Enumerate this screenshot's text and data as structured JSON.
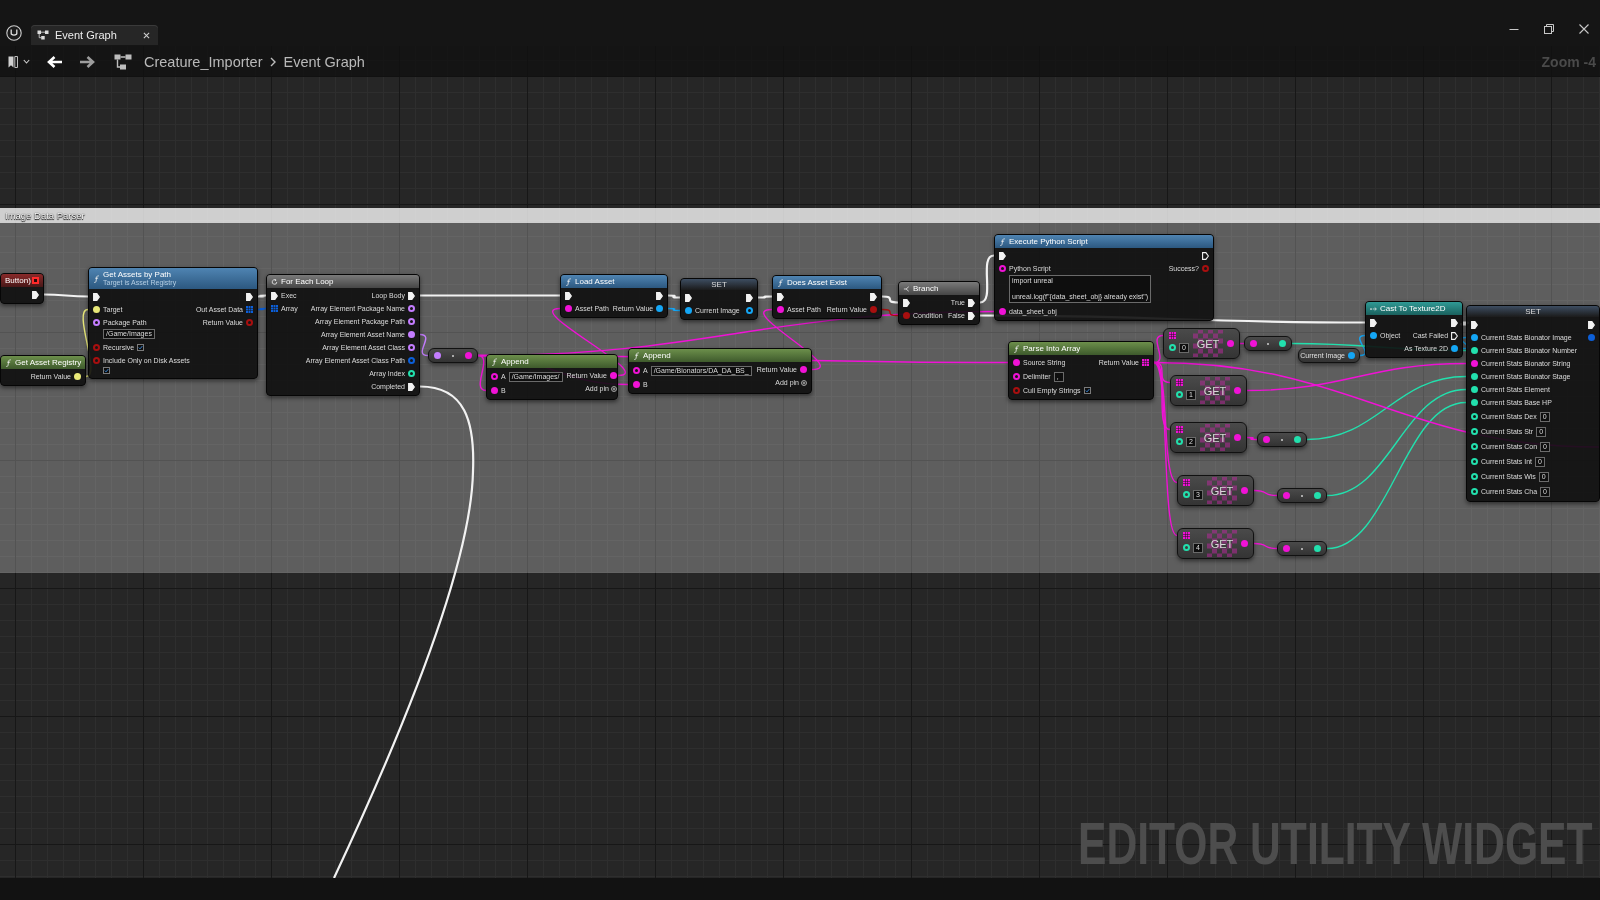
{
  "tabs": [
    {
      "label": "Event Graph",
      "selected": true
    }
  ],
  "nav_buttons": [
    {
      "disabled": false
    },
    {
      "disabled": true
    }
  ],
  "breadcrumb": [
    "Creature_Importer",
    "Event Graph"
  ],
  "zoom_label": "Zoom -4",
  "comment": {
    "title": "Image Data Parser"
  },
  "nodes": [
    {
      "kind": "event",
      "title": "Button)",
      "outputs": [
        {
          "kind": "delegate",
          "color": "#ff2a2a",
          "linked": false
        },
        {
          "kind": "exec",
          "linked": true
        }
      ]
    },
    {
      "kind": "function",
      "title": "Get Assets by Path",
      "subtitle": "Target is Asset Registry",
      "inputs": [
        {
          "kind": "exec",
          "linked": true
        },
        {
          "kind": "value",
          "color": "#e8e878",
          "label": "Target",
          "linked": true
        },
        {
          "kind": "value",
          "color": "#c47dff",
          "label": "Package Path",
          "linked": false,
          "value": "/Game/Images"
        },
        {
          "kind": "value",
          "color": "#a80f0f",
          "label": "Recursive",
          "linked": false,
          "checked": true
        },
        {
          "kind": "value",
          "color": "#a80f0f",
          "label": "Include Only on Disk Assets",
          "linked": false,
          "checked": true
        }
      ],
      "outputs": [
        {
          "kind": "exec",
          "linked": true
        },
        {
          "kind": "array",
          "color": "#0c5fd8",
          "label": "Out Asset Data",
          "linked": true
        },
        {
          "kind": "value",
          "color": "#a80f0f",
          "label": "Return Value",
          "linked": false
        }
      ]
    },
    {
      "kind": "pure",
      "title": "Get Asset Registry",
      "outputs": [
        {
          "kind": "value",
          "color": "#e8e878",
          "label": "Return Value",
          "linked": true
        }
      ]
    },
    {
      "kind": "loop",
      "title": "For Each Loop",
      "inputs": [
        {
          "kind": "exec",
          "label": "Exec",
          "linked": true
        },
        {
          "kind": "array",
          "color": "#0c5fd8",
          "label": "Array",
          "linked": true
        }
      ],
      "outputs": [
        {
          "kind": "exec",
          "label": "Loop Body",
          "linked": true
        },
        {
          "kind": "value",
          "color": "#c47dff",
          "label": "Array Element Package Name",
          "linked": false
        },
        {
          "kind": "value",
          "color": "#c47dff",
          "label": "Array Element Package Path",
          "linked": false
        },
        {
          "kind": "value",
          "color": "#c47dff",
          "label": "Array Element Asset Name",
          "linked": true
        },
        {
          "kind": "value",
          "color": "#c47dff",
          "label": "Array Element Asset Class",
          "linked": false
        },
        {
          "kind": "value",
          "color": "#0c5fd8",
          "label": "Array Element Asset Class Path",
          "linked": false
        },
        {
          "kind": "value",
          "color": "#22e0ad",
          "label": "Array Index",
          "linked": false
        },
        {
          "kind": "exec",
          "label": "Completed",
          "linked": true
        }
      ]
    },
    {
      "kind": "conversion",
      "inputs": [
        {
          "kind": "value",
          "color": "#c47dff",
          "linked": true
        }
      ],
      "outputs": [
        {
          "kind": "value",
          "color": "#f012d6",
          "linked": true
        }
      ]
    },
    {
      "kind": "pure",
      "title": "Append",
      "inputs": [
        {
          "kind": "value",
          "color": "#f012d6",
          "label": "A",
          "linked": false,
          "value": "/Game/Images/"
        },
        {
          "kind": "value",
          "color": "#f012d6",
          "label": "B",
          "linked": true
        }
      ],
      "outputs": [
        {
          "kind": "value",
          "color": "#f012d6",
          "label": "Return Value",
          "linked": true
        },
        {
          "kind": "add",
          "label": "Add pin"
        }
      ]
    },
    {
      "kind": "function",
      "title": "Load Asset",
      "inputs": [
        {
          "kind": "exec",
          "linked": true
        },
        {
          "kind": "value",
          "color": "#f012d6",
          "label": "Asset Path",
          "linked": true
        }
      ],
      "outputs": [
        {
          "kind": "exec",
          "linked": true
        },
        {
          "kind": "value",
          "color": "#14a6f5",
          "label": "Return Value",
          "linked": true
        }
      ]
    },
    {
      "kind": "set",
      "title": "SET",
      "inputs": [
        {
          "kind": "exec",
          "linked": true
        },
        {
          "kind": "value",
          "color": "#14a6f5",
          "label": "Current Image",
          "linked": true
        }
      ],
      "outputs": [
        {
          "kind": "exec",
          "linked": true
        },
        {
          "kind": "value",
          "color": "#14a6f5",
          "linked": false
        }
      ]
    },
    {
      "kind": "pure",
      "title": "Append",
      "inputs": [
        {
          "kind": "value",
          "color": "#f012d6",
          "label": "A",
          "linked": false,
          "value": "/Game/Bionators/DA_DA_BS_"
        },
        {
          "kind": "value",
          "color": "#f012d6",
          "label": "B",
          "linked": true
        }
      ],
      "outputs": [
        {
          "kind": "value",
          "color": "#f012d6",
          "label": "Return Value",
          "linked": true
        },
        {
          "kind": "add",
          "label": "Add pin"
        }
      ]
    },
    {
      "kind": "function",
      "title": "Does Asset Exist",
      "inputs": [
        {
          "kind": "exec",
          "linked": true
        },
        {
          "kind": "value",
          "color": "#f012d6",
          "label": "Asset Path",
          "linked": true
        }
      ],
      "outputs": [
        {
          "kind": "exec",
          "linked": true
        },
        {
          "kind": "value",
          "color": "#a80f0f",
          "label": "Return Value",
          "linked": true
        }
      ]
    },
    {
      "kind": "branch",
      "title": "Branch",
      "inputs": [
        {
          "kind": "exec",
          "linked": true
        },
        {
          "kind": "value",
          "color": "#a80f0f",
          "label": "Condition",
          "linked": true
        }
      ],
      "outputs": [
        {
          "kind": "exec",
          "label": "True",
          "linked": true
        },
        {
          "kind": "exec",
          "label": "False",
          "linked": true
        }
      ]
    },
    {
      "kind": "function",
      "title": "Execute Python Script",
      "inputs": [
        {
          "kind": "exec",
          "linked": true
        },
        {
          "kind": "value",
          "color": "#f012d6",
          "label": "Python Script",
          "linked": false,
          "value": "import unreal\n\nunreal.log(f\"{data_sheet_obj} already exist\")"
        },
        {
          "kind": "value",
          "color": "#f012d6",
          "label": "data_sheet_obj",
          "linked": true
        }
      ],
      "outputs": [
        {
          "kind": "exec",
          "linked": false
        },
        {
          "kind": "value",
          "color": "#a80f0f",
          "label": "Success?",
          "linked": false
        }
      ]
    },
    {
      "kind": "pure",
      "title": "Parse Into Array",
      "inputs": [
        {
          "kind": "value",
          "color": "#f012d6",
          "label": "Source String",
          "linked": true
        },
        {
          "kind": "value",
          "color": "#f012d6",
          "label": "Delimiter",
          "linked": false,
          "value": ","
        },
        {
          "kind": "value",
          "color": "#a80f0f",
          "label": "Cull Empty Strings",
          "linked": false,
          "checked": true
        }
      ],
      "outputs": [
        {
          "kind": "array",
          "color": "#f012d6",
          "label": "Return Value",
          "linked": true
        }
      ]
    },
    {
      "kind": "array_get",
      "title": "GET",
      "inputs": [
        {
          "kind": "array",
          "color": "#f012d6",
          "linked": true
        },
        {
          "kind": "value",
          "color": "#22e0ad",
          "linked": false,
          "value": "0"
        }
      ],
      "outputs": [
        {
          "kind": "value",
          "color": "#f012d6",
          "linked": true
        }
      ]
    },
    {
      "kind": "conversion",
      "inputs": [
        {
          "kind": "value",
          "color": "#f012d6",
          "linked": true
        }
      ],
      "outputs": [
        {
          "kind": "value",
          "color": "#22e0ad",
          "linked": true
        }
      ]
    },
    {
      "kind": "getter",
      "title": "Current Image",
      "outputs": [
        {
          "kind": "value",
          "color": "#14a6f5",
          "linked": true
        }
      ]
    },
    {
      "kind": "cast",
      "title": "Cast To Texture2D",
      "inputs": [
        {
          "kind": "exec",
          "linked": true
        },
        {
          "kind": "value",
          "color": "#14a6f5",
          "label": "Object",
          "linked": true
        }
      ],
      "outputs": [
        {
          "kind": "exec",
          "linked": true
        },
        {
          "kind": "exec",
          "label": "Cast Failed",
          "linked": false
        },
        {
          "kind": "value",
          "color": "#14a6f5",
          "label": "As Texture 2D",
          "linked": true
        }
      ]
    },
    {
      "kind": "set",
      "title": "SET",
      "inputs": [
        {
          "kind": "exec",
          "linked": true
        },
        {
          "kind": "value",
          "color": "#14a6f5",
          "label": "Current Stats Bionator Image",
          "linked": true
        },
        {
          "kind": "value",
          "color": "#22e0ad",
          "label": "Current Stats Bionator Number",
          "linked": true
        },
        {
          "kind": "value",
          "color": "#f012d6",
          "label": "Current Stats Bionator String",
          "linked": true
        },
        {
          "kind": "value",
          "color": "#22e0ad",
          "label": "Current Stats Bionator Stage",
          "linked": true
        },
        {
          "kind": "value",
          "color": "#22e0ad",
          "label": "Current Stats Element",
          "linked": true
        },
        {
          "kind": "value",
          "color": "#22e0ad",
          "label": "Current Stats Base HP",
          "linked": true
        },
        {
          "kind": "value",
          "color": "#22e0ad",
          "label": "Current Stats Dex",
          "linked": false,
          "value": "0"
        },
        {
          "kind": "value",
          "color": "#22e0ad",
          "label": "Current Stats Str",
          "linked": false,
          "value": "0"
        },
        {
          "kind": "value",
          "color": "#22e0ad",
          "label": "Current Stats Con",
          "linked": false,
          "value": "0"
        },
        {
          "kind": "value",
          "color": "#22e0ad",
          "label": "Current Stats Int",
          "linked": false,
          "value": "0"
        },
        {
          "kind": "value",
          "color": "#22e0ad",
          "label": "Current Stats Wis",
          "linked": false,
          "value": "0"
        },
        {
          "kind": "value",
          "color": "#22e0ad",
          "label": "Current Stats Cha",
          "linked": false,
          "value": "0"
        }
      ],
      "outputs": [
        {
          "kind": "exec",
          "linked": true
        },
        {
          "kind": "value",
          "color": "#0c5fd8",
          "linked": true
        }
      ]
    },
    {
      "kind": "array_get",
      "title": "GET",
      "inputs": [
        {
          "kind": "array",
          "color": "#f012d6",
          "linked": true
        },
        {
          "kind": "value",
          "color": "#22e0ad",
          "linked": false,
          "value": "1"
        }
      ],
      "outputs": [
        {
          "kind": "value",
          "color": "#f012d6",
          "linked": true
        }
      ]
    },
    {
      "kind": "array_get",
      "title": "GET",
      "inputs": [
        {
          "kind": "array",
          "color": "#f012d6",
          "linked": true
        },
        {
          "kind": "value",
          "color": "#22e0ad",
          "linked": false,
          "value": "2"
        }
      ],
      "outputs": [
        {
          "kind": "value",
          "color": "#f012d6",
          "linked": true
        }
      ]
    },
    {
      "kind": "conversion",
      "inputs": [
        {
          "kind": "value",
          "color": "#f012d6",
          "linked": true
        }
      ],
      "outputs": [
        {
          "kind": "value",
          "color": "#22e0ad",
          "linked": true
        }
      ]
    },
    {
      "kind": "array_get",
      "title": "GET",
      "inputs": [
        {
          "kind": "array",
          "color": "#f012d6",
          "linked": true
        },
        {
          "kind": "value",
          "color": "#22e0ad",
          "linked": false,
          "value": "3"
        }
      ],
      "outputs": [
        {
          "kind": "value",
          "color": "#f012d6",
          "linked": true
        }
      ]
    },
    {
      "kind": "conversion",
      "inputs": [
        {
          "kind": "value",
          "color": "#f012d6",
          "linked": true
        }
      ],
      "outputs": [
        {
          "kind": "value",
          "color": "#22e0ad",
          "linked": true
        }
      ]
    },
    {
      "kind": "array_get",
      "title": "GET",
      "inputs": [
        {
          "kind": "array",
          "color": "#f012d6",
          "linked": true
        },
        {
          "kind": "value",
          "color": "#22e0ad",
          "linked": false,
          "value": "4"
        }
      ],
      "outputs": [
        {
          "kind": "value",
          "color": "#f012d6",
          "linked": true
        }
      ]
    },
    {
      "kind": "conversion",
      "inputs": [
        {
          "kind": "value",
          "color": "#f012d6",
          "linked": true
        }
      ],
      "outputs": [
        {
          "kind": "value",
          "color": "#22e0ad",
          "linked": true
        }
      ]
    }
  ],
  "graph_type_label": "EDITOR UTILITY WIDGET"
}
